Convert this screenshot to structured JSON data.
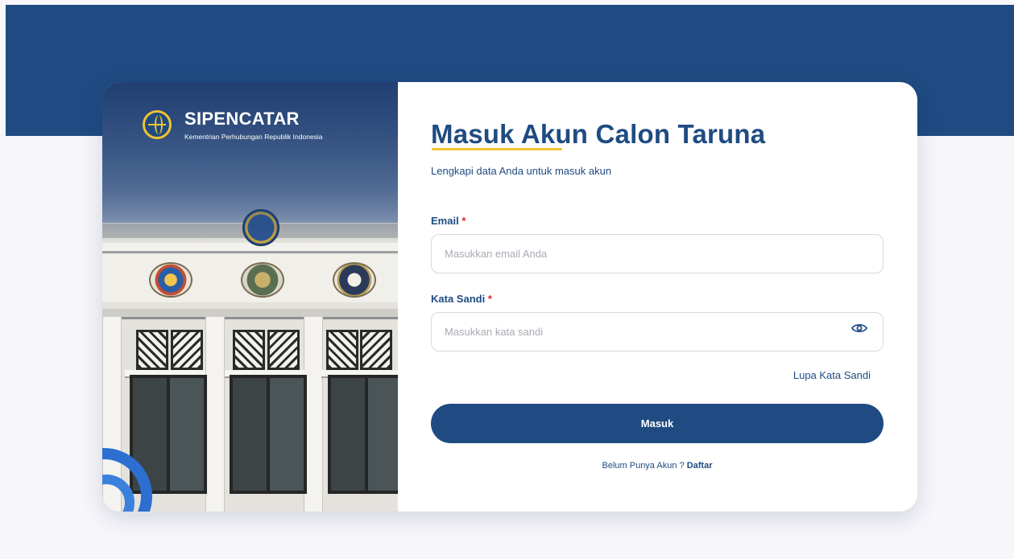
{
  "brand": {
    "name": "SIPENCATAR",
    "subtitle": "Kementrian Perhubungan Republik Indonesia"
  },
  "form": {
    "title": "Masuk Akun Calon Taruna",
    "subtitle": "Lengkapi data Anda untuk masuk akun",
    "required_marker": "*",
    "email": {
      "label": "Email",
      "placeholder": "Masukkan email Anda",
      "value": ""
    },
    "password": {
      "label": "Kata Sandi",
      "placeholder": "Masukkan kata sandi",
      "value": ""
    },
    "forgot_link": "Lupa Kata Sandi",
    "submit_label": "Masuk",
    "register_prompt": "Belum Punya Akun ?",
    "register_link": "Daftar"
  },
  "colors": {
    "primary": "#1f4b82",
    "accent": "#f2c230",
    "required": "#e0262a",
    "page_background": "#f7f6fb"
  },
  "icons": {
    "logo": "globe-emblem-icon",
    "password_toggle": "eye-icon"
  }
}
